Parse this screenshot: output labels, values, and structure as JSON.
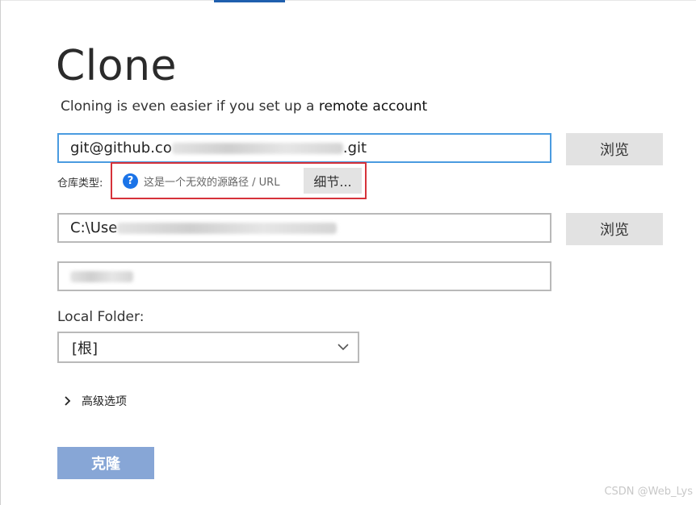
{
  "header": {
    "title": "Clone",
    "subtitle_prefix": "Cloning is even easier if you set up a ",
    "subtitle_link": "remote account"
  },
  "source": {
    "value_prefix": "git@github.co",
    "value_suffix": ".git",
    "browse_label": "浏览"
  },
  "repo_type": {
    "label": "仓库类型:",
    "warning_text": "这是一个无效的源路径 / URL",
    "details_label": "细节..."
  },
  "destination": {
    "value_prefix": "C:\\Use",
    "browse_label": "浏览"
  },
  "name_field": {},
  "local_folder": {
    "label": "Local Folder:",
    "selected": "[根]"
  },
  "advanced": {
    "label": "高级选项"
  },
  "actions": {
    "clone_label": "克隆"
  },
  "watermark": "CSDN @Web_Lys",
  "colors": {
    "focus_border": "#4a9be0",
    "warning_border": "#d6323a",
    "info_icon": "#1a73e8",
    "primary_button": "#87a6d6"
  }
}
